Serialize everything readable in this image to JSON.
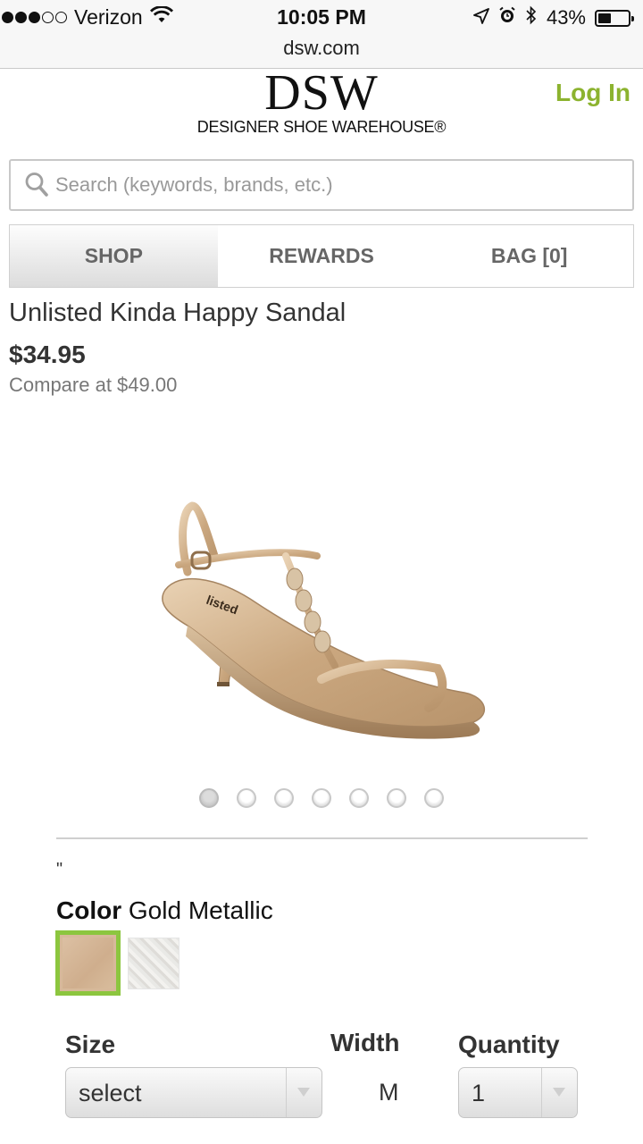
{
  "status_bar": {
    "carrier": "Verizon",
    "signal_bars_filled": 3,
    "signal_bars_total": 5,
    "time": "10:05 PM",
    "battery_percent": "43%",
    "battery_level": 0.43,
    "icons": [
      "wifi-icon",
      "location-arrow-icon",
      "alarm-icon",
      "bluetooth-icon",
      "battery-icon"
    ]
  },
  "browser": {
    "url": "dsw.com"
  },
  "header": {
    "logo_text": "DSW",
    "logo_tagline": "DESIGNER SHOE WAREHOUSE®",
    "login_label": "Log In",
    "accent_color": "#8cb32f"
  },
  "search": {
    "placeholder": "Search (keywords, brands, etc.)",
    "value": ""
  },
  "nav": {
    "tabs": [
      {
        "label": "SHOP",
        "active": true
      },
      {
        "label": "REWARDS",
        "active": false
      },
      {
        "label": "BAG [0]",
        "active": false
      }
    ]
  },
  "product": {
    "title": "Unlisted Kinda Happy Sandal",
    "price": "$34.95",
    "compare_price": "Compare at $49.00",
    "image_count": 7,
    "active_image_index": 0,
    "stray_text": "\"",
    "color_label": "Color",
    "color_value": "Gold Metallic",
    "swatches": [
      {
        "name": "Gold Metallic",
        "selected": true,
        "color": "#d7b99a"
      },
      {
        "name": "Silver",
        "selected": false,
        "color": "#e6e5e2"
      }
    ],
    "selected_swatch_border": "#8cc63f"
  },
  "options": {
    "size_label": "Size",
    "size_value": "select",
    "width_label": "Width",
    "width_value": "M",
    "quantity_label": "Quantity",
    "quantity_value": "1"
  }
}
